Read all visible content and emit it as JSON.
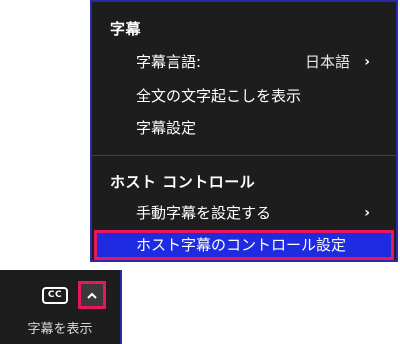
{
  "menu": {
    "section_captions": {
      "title": "字幕",
      "items": [
        {
          "label": "字幕言語:",
          "value": "日本語",
          "chevron": "›"
        },
        {
          "label": "全文の文字起こしを表示"
        },
        {
          "label": "字幕設定"
        }
      ]
    },
    "section_host": {
      "title": "ホスト コントロール",
      "items": [
        {
          "label": "手動字幕を設定する",
          "chevron": "›"
        },
        {
          "label": "ホスト字幕のコントロール設定",
          "highlighted": true
        }
      ]
    }
  },
  "toolbar": {
    "cc_icon_text": "CC",
    "caret_icon": "chevron-up-icon",
    "label": "字幕を表示"
  },
  "colors": {
    "menu_bg": "#1d1d1d",
    "highlight_bg": "#1f2be0",
    "annotation_box": "#e8175d",
    "border": "#2a2aa8"
  }
}
